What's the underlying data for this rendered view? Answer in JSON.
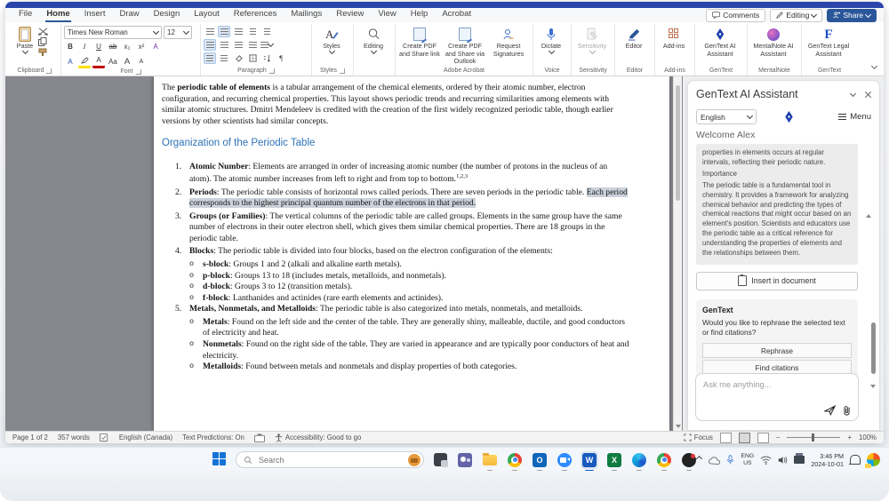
{
  "menubar": {
    "tabs": [
      "File",
      "Home",
      "Insert",
      "Draw",
      "Design",
      "Layout",
      "References",
      "Mailings",
      "Review",
      "View",
      "Help",
      "Acrobat"
    ],
    "comments": "Comments",
    "editing": "Editing",
    "share": "Share"
  },
  "ribbon": {
    "font_name": "Times New Roman",
    "font_size": "12",
    "paste": "Paste",
    "grp_clipboard": "Clipboard",
    "grp_font": "Font",
    "grp_paragraph": "Paragraph",
    "btn_b": "B",
    "btn_i": "I",
    "btn_u": "U",
    "btn_ab": "ab",
    "btn_sub": "x₂",
    "btn_sup": "x²",
    "btn_a1": "A",
    "btn_a2": "A",
    "btn_aa": "Aa",
    "btn_a3": "A",
    "btn_a4": "A",
    "styles": "Styles",
    "grp_styles": "Styles",
    "editing": "Editing",
    "acrobat1": "Create PDF and Share link",
    "acrobat2": "Create PDF and Share via Outlook",
    "acrobat3": "Request Signatures",
    "grp_acrobat": "Adobe Acrobat",
    "dictate": "Dictate",
    "grp_voice": "Voice",
    "sensitivity": "Sensitivity",
    "grp_sensitivity": "Sensitivity",
    "editor": "Editor",
    "grp_editor": "Editor",
    "addins": "Add-ins",
    "grp_addins": "Add-ins",
    "gentext_ai": "GenText AI Assistant",
    "grp_gentext1": "GenText",
    "mentalnote": "MentalNote AI Assistant",
    "grp_mentalnote": "MentalNote",
    "legal": "GenText Legal Assistant",
    "grp_gentext2": "GenText"
  },
  "doc": {
    "sep": ": ",
    "bullet": "o",
    "p1a": "The ",
    "p1b": "periodic table of elements",
    "p1c": " is a tabular arrangement of the chemical elements, ordered by their atomic number, electron configuration, and recurring chemical properties. This layout shows periodic trends and recurring similarities among elements with similar atomic structures. Dmitri Mendeleev is credited with the creation of the first widely recognized periodic table, though earlier versions by other scientists had similar concepts.",
    "heading": "Organization of the Periodic Table",
    "items": [
      {
        "num": "1.",
        "term": "Atomic Number",
        "text": "Elements are arranged in order of increasing atomic number (the number of protons in the nucleus of an atom). The atomic number increases from left to right and from top to bottom.",
        "sup": "1,2,3"
      },
      {
        "num": "2.",
        "term": "Periods",
        "text": "The periodic table consists of horizontal rows called periods. There are seven periods in the periodic table. ",
        "hl": "Each period corresponds to the highest principal quantum number of the electrons in that period."
      },
      {
        "num": "3.",
        "term": "Groups (or Families)",
        "text": "The vertical columns of the periodic table are called groups. Elements in the same group have the same number of electrons in their outer electron shell, which gives them similar chemical properties. There are 18 groups in the periodic table."
      },
      {
        "num": "4.",
        "term": "Blocks",
        "text": "The periodic table is divided into four blocks, based on the electron configuration of the elements:",
        "sub": [
          {
            "term": "s-block",
            "text": "Groups 1 and 2 (alkali and alkaline earth metals)."
          },
          {
            "term": "p-block",
            "text": "Groups 13 to 18 (includes metals, metalloids, and nonmetals)."
          },
          {
            "term": "d-block",
            "text": "Groups 3 to 12 (transition metals)."
          },
          {
            "term": "f-block",
            "text": "Lanthanides and actinides (rare earth elements and actinides)."
          }
        ]
      },
      {
        "num": "5.",
        "term": "Metals, Nonmetals, and Metalloids",
        "text": "The periodic table is also categorized into metals, nonmetals, and metalloids.",
        "sub": [
          {
            "term": "Metals",
            "text": "Found on the left side and the center of the table. They are generally shiny, malleable, ductile, and good conductors of electricity and heat."
          },
          {
            "term": "Nonmetals",
            "text": "Found on the right side of the table. They are varied in appearance and are typically poor conductors of heat and electricity."
          },
          {
            "term": "Metalloids",
            "text": "Found between metals and nonmetals and display properties of both categories."
          }
        ]
      }
    ]
  },
  "panel": {
    "title": "GenText AI Assistant",
    "language": "English",
    "menu": "Menu",
    "welcome": "Welcome Alex",
    "resp1": "properties in elements occurs at regular intervals, reflecting their periodic nature.",
    "resp2": "Importance",
    "resp3": "The periodic table is a fundamental tool in chemistry. It provides a framework for analyzing chemical behavior and predicting the types of chemical reactions that might occur based on an element's position. Scientists and educators use the periodic table as a critical reference for understanding the properties of elements and the relationships between them.",
    "insert_btn": "Insert in document",
    "card_title": "GenText",
    "card_q": "Would you like to rephrase the selected text or find citations?",
    "rephrase": "Rephrase",
    "find": "Find citations",
    "placeholder": "Ask me anything..."
  },
  "status": {
    "page": "Page 1 of 2",
    "words": "357 words",
    "lang": "English (Canada)",
    "pred": "Text Predictions: On",
    "acc": "Accessibility: Good to go",
    "focus": "Focus",
    "zoom_out": "−",
    "zoom_in": "+",
    "zoom": "100%"
  },
  "task": {
    "search": "Search",
    "eng": "ENG",
    "us": "US",
    "time": "3:46 PM",
    "date": "2024-10-01"
  }
}
